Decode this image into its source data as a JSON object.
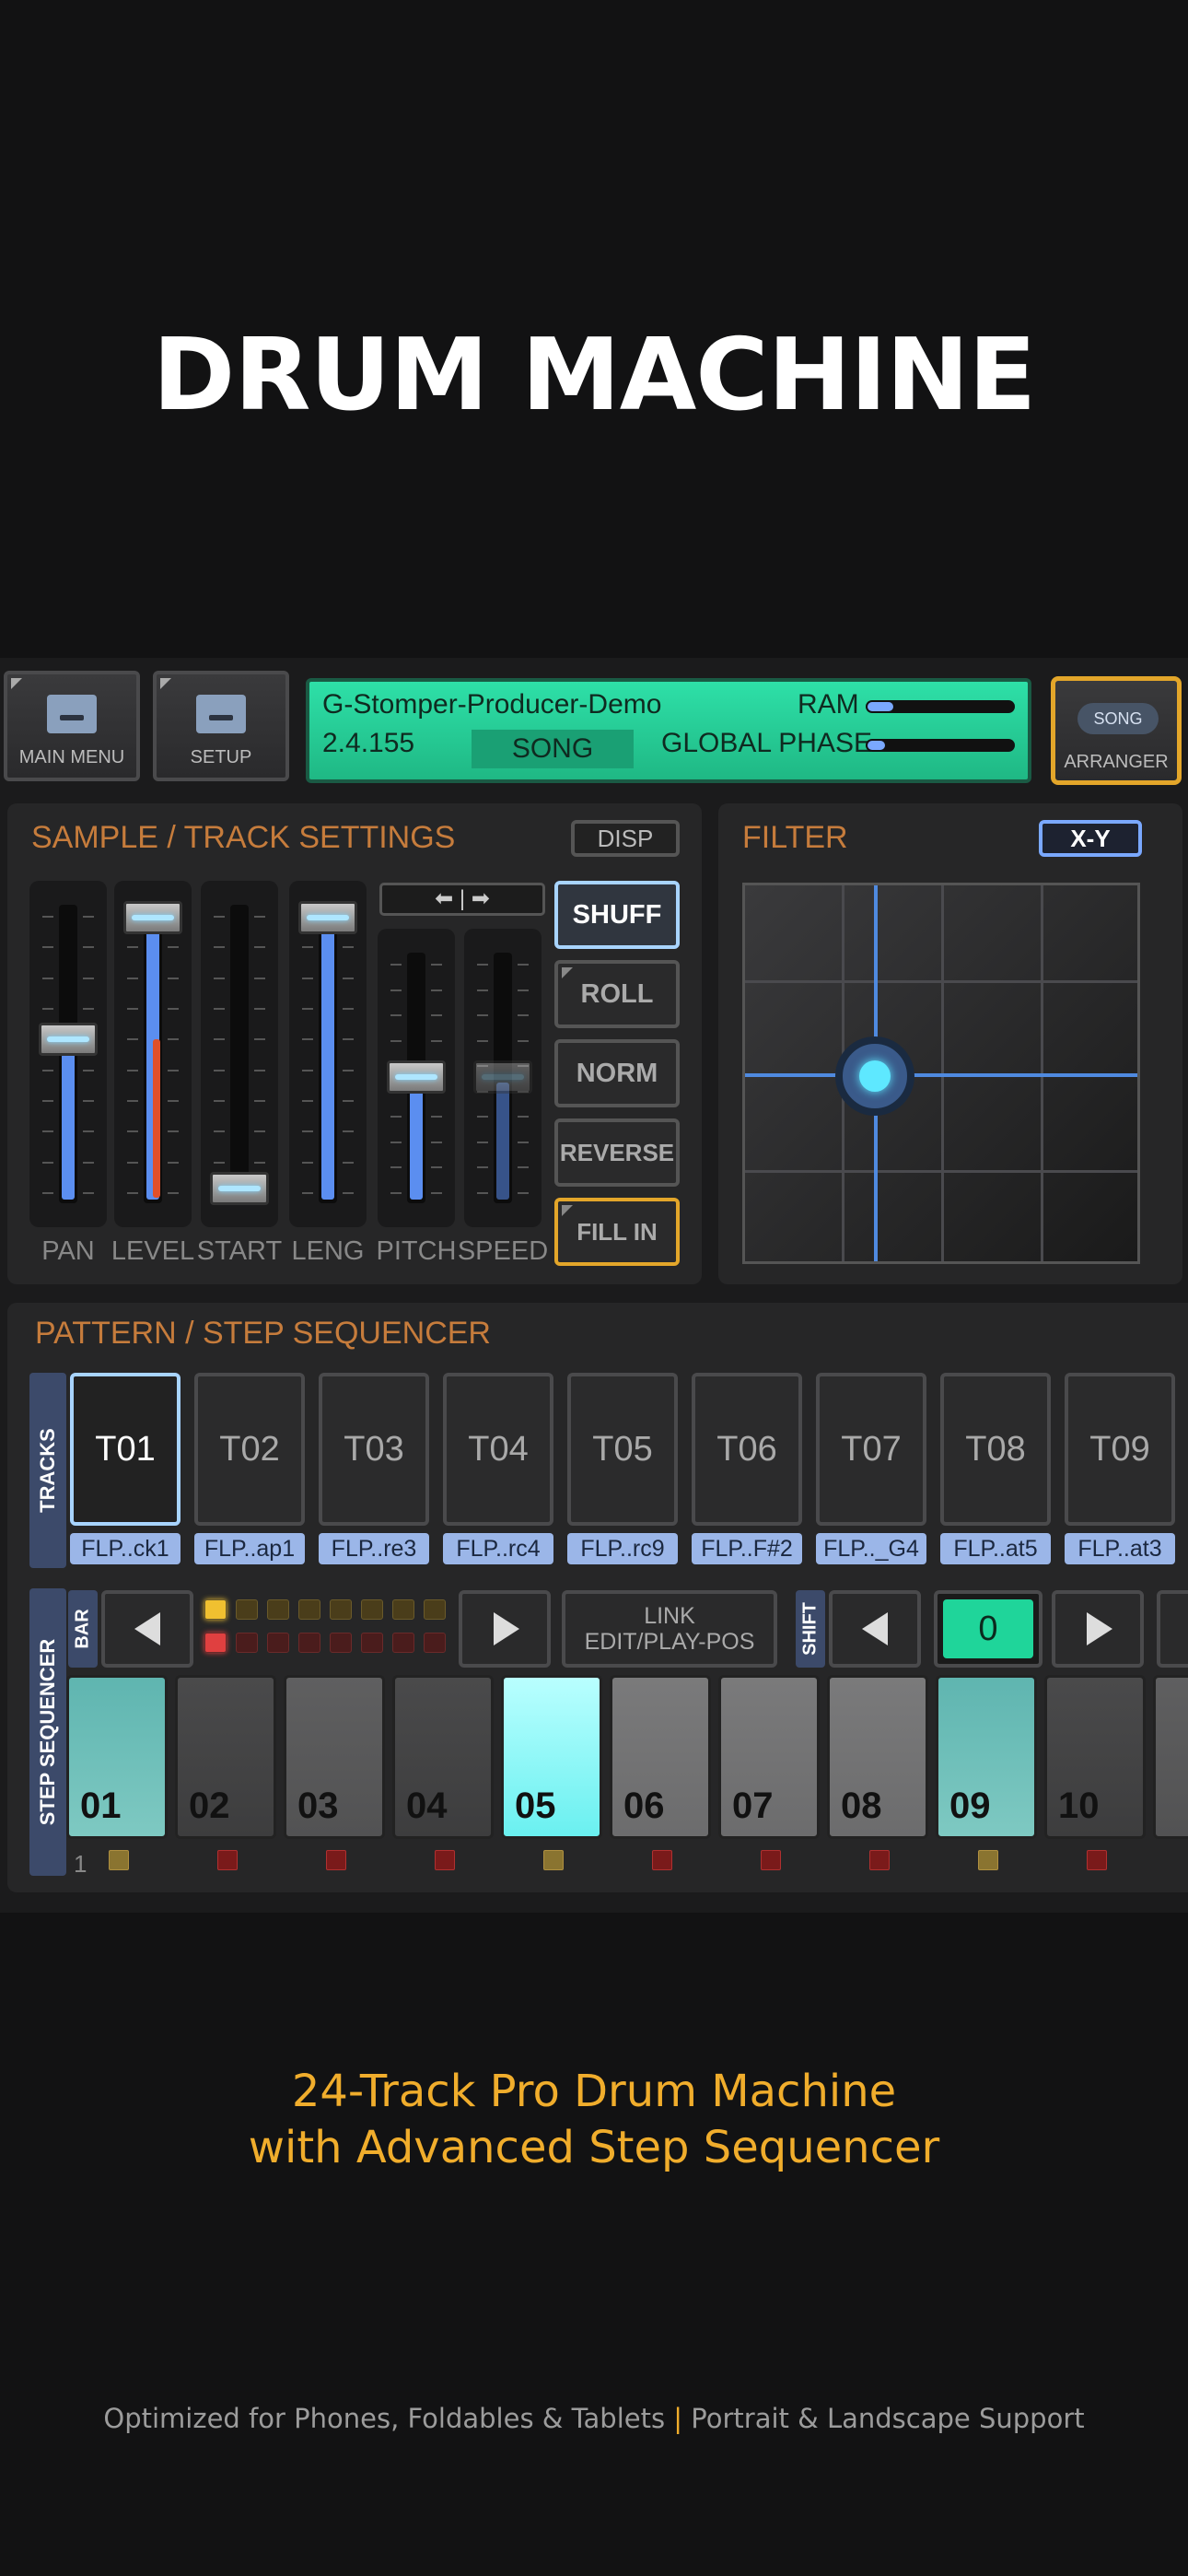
{
  "headline": "DRUM MACHINE",
  "tagline": {
    "line1": "24-Track Pro Drum Machine",
    "line2": "with Advanced Step Sequencer"
  },
  "footer": {
    "left": "Optimized for Phones, Foldables & Tablets",
    "separator": "|",
    "right": "Portrait & Landscape Support"
  },
  "topbar": {
    "main_menu": "MAIN MENU",
    "setup": "SETUP",
    "project_name": "G-Stomper-Producer-Demo",
    "version": "2.4.155",
    "mode": "SONG",
    "ram_label": "RAM",
    "global_phase_label": "GLOBAL PHASE",
    "ram_level": 0.18,
    "global_phase_level": 0.12,
    "song_pill": "SONG",
    "arranger": "ARRANGER"
  },
  "sample_panel": {
    "title": "SAMPLE / TRACK SETTINGS",
    "disp": "DISP",
    "sliders": [
      {
        "label": "PAN",
        "value": 0.55
      },
      {
        "label": "LEVEL",
        "value": 1.0
      },
      {
        "label": "START",
        "value": 0.0
      },
      {
        "label": "LENG",
        "value": 1.0
      },
      {
        "label": "PITCH",
        "value": 0.5
      },
      {
        "label": "SPEED",
        "value": 0.5
      }
    ],
    "modes": [
      "SHUFF",
      "ROLL",
      "NORM",
      "REVERSE",
      "FILL IN"
    ]
  },
  "filter_panel": {
    "title": "FILTER",
    "xy": "X-Y"
  },
  "sequencer": {
    "title": "PATTERN / STEP SEQUENCER",
    "tracks_label": "TRACKS",
    "tracks": [
      {
        "id": "T01",
        "name": "FLP..ck1"
      },
      {
        "id": "T02",
        "name": "FLP..ap1"
      },
      {
        "id": "T03",
        "name": "FLP..re3"
      },
      {
        "id": "T04",
        "name": "FLP..rc4"
      },
      {
        "id": "T05",
        "name": "FLP..rc9"
      },
      {
        "id": "T06",
        "name": "FLP..F#2"
      },
      {
        "id": "T07",
        "name": "FLP.._G4"
      },
      {
        "id": "T08",
        "name": "FLP..at5"
      },
      {
        "id": "T09",
        "name": "FLP..at3"
      }
    ],
    "bar_label": "BAR",
    "link_line1": "LINK",
    "link_line2": "EDIT/PLAY-POS",
    "shift_label": "SHIFT",
    "shift_value": "0",
    "step_seq_label": "STEP SEQUENCER",
    "bar_number": "1",
    "steps": [
      "01",
      "02",
      "03",
      "04",
      "05",
      "06",
      "07",
      "08",
      "09",
      "10"
    ],
    "cut_step_label": "1"
  }
}
